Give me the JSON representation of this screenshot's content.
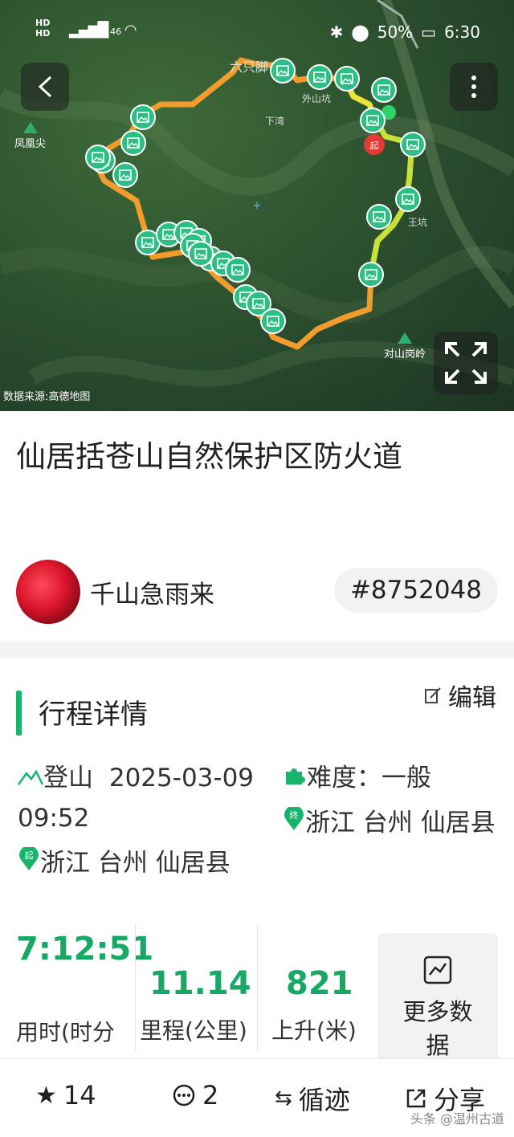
{
  "status_bar": {
    "left_top": "HD",
    "left_bottom": "HD",
    "network": "46",
    "battery": "50%",
    "time": "6:30"
  },
  "map": {
    "source": "数据来源:高德地图",
    "peaks": [
      {
        "name": "凤凰尖"
      },
      {
        "name": "对山岗岭"
      }
    ],
    "place_labels": [
      "六只脚",
      "下湾",
      "外山坑",
      "王坑"
    ],
    "route_color_start": "#f39c2e",
    "route_color_end": "#c6e23a",
    "marker_color": "#2dbe86"
  },
  "trip": {
    "title": "仙居括苍山自然保护区防火道",
    "author": "千山急雨来",
    "id": "#8752048"
  },
  "details": {
    "section_title": "行程详情",
    "edit_label": "编辑",
    "type_label": "登山",
    "start_time": "2025-03-09 09:52",
    "difficulty_label": "难度：一般",
    "end_place": "浙江 台州 仙居县",
    "start_place": "浙江 台州 仙居县",
    "start_badge": "起",
    "end_badge": "终"
  },
  "stats": {
    "duration_value": "7:12:51",
    "duration_label": "用时(时分秒)",
    "distance_value": "11.14",
    "distance_label": "里程(公里)",
    "ascent_value": "821",
    "ascent_label": "上升(米)",
    "more_label": "更多数据"
  },
  "bottom_bar": {
    "favorites": "14",
    "comments": "2",
    "follow_track": "循迹",
    "share": "分享"
  },
  "watermark": "头条 @温州古道",
  "accent": "#19b46b"
}
